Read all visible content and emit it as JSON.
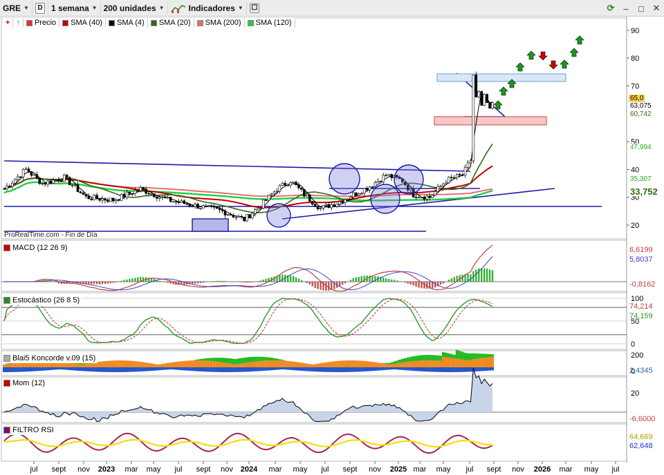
{
  "toolbar": {
    "symbol": "GRE",
    "timeframe_badge": "D",
    "period": "1 semana",
    "units": "200 unidades",
    "indicators": "Indicadores"
  },
  "legend": [
    {
      "label": "Precio",
      "color": "#d33"
    },
    {
      "label": "SMA (40)",
      "color": "#c00000"
    },
    {
      "label": "SMA (4)",
      "color": "#000000"
    },
    {
      "label": "SMA (20)",
      "color": "#2f6b12"
    },
    {
      "label": "SMA (200)",
      "color": "#e07070"
    },
    {
      "label": "SMA (120)",
      "color": "#22cc44"
    }
  ],
  "watermark": "ProRealTime.com - Fin de Día",
  "price_axis": {
    "ticks": [
      "90",
      "80",
      "70",
      "50",
      "40",
      "30",
      "20"
    ],
    "tags": [
      {
        "text": "65,0",
        "bg": "#ffd24d",
        "color": "#000"
      },
      {
        "text": "63,075",
        "bg": "#ffffff",
        "color": "#000"
      },
      {
        "text": "60,742",
        "bg": "#ffffff",
        "color": "#2f6b12"
      },
      {
        "text": "47,994",
        "bg": "#ffffff",
        "color": "#22aa22"
      },
      {
        "text": "35,307",
        "bg": "#ffffff",
        "color": "#22aa22"
      },
      {
        "text": "33,752",
        "bg": "#ffffff",
        "color": "#2f6b12"
      }
    ]
  },
  "panels": {
    "macd": {
      "label": "MACD (12 26 9)",
      "tags": [
        "6,6199",
        "5,8037",
        "-0,8162"
      ]
    },
    "stoch": {
      "label": "Estocástico (26 8 5)",
      "ticks": [
        "100",
        "50",
        "0"
      ],
      "tags": [
        "74,214",
        "74,159"
      ]
    },
    "koncorde": {
      "label": "Blai5 Koncorde v.09 (15)",
      "ticks": [
        "200",
        "0"
      ],
      "tags": [
        "2,4345"
      ]
    },
    "mom": {
      "label": "Mom (12)",
      "ticks": [
        "20"
      ],
      "tags": [
        "-6,6000"
      ]
    },
    "rsi": {
      "label": "FILTRO RSI",
      "tags": [
        "64,669",
        "62,648"
      ]
    }
  },
  "x_axis": [
    {
      "label": "jul",
      "bold": false
    },
    {
      "label": "sept",
      "bold": false
    },
    {
      "label": "nov",
      "bold": false
    },
    {
      "label": "2023",
      "bold": true
    },
    {
      "label": "mar",
      "bold": false
    },
    {
      "label": "may",
      "bold": false
    },
    {
      "label": "jul",
      "bold": false
    },
    {
      "label": "sept",
      "bold": false
    },
    {
      "label": "nov",
      "bold": false
    },
    {
      "label": "2024",
      "bold": true
    },
    {
      "label": "mar",
      "bold": false
    },
    {
      "label": "may",
      "bold": false
    },
    {
      "label": "jul",
      "bold": false
    },
    {
      "label": "sept",
      "bold": false
    },
    {
      "label": "nov",
      "bold": false
    },
    {
      "label": "2025",
      "bold": true
    },
    {
      "label": "mar",
      "bold": false
    },
    {
      "label": "may",
      "bold": false
    },
    {
      "label": "jul",
      "bold": false
    },
    {
      "label": "sept",
      "bold": false
    },
    {
      "label": "nov",
      "bold": false
    },
    {
      "label": "2026",
      "bold": true
    },
    {
      "label": "mar",
      "bold": false
    },
    {
      "label": "may",
      "bold": false
    },
    {
      "label": "jul",
      "bold": false
    }
  ]
}
